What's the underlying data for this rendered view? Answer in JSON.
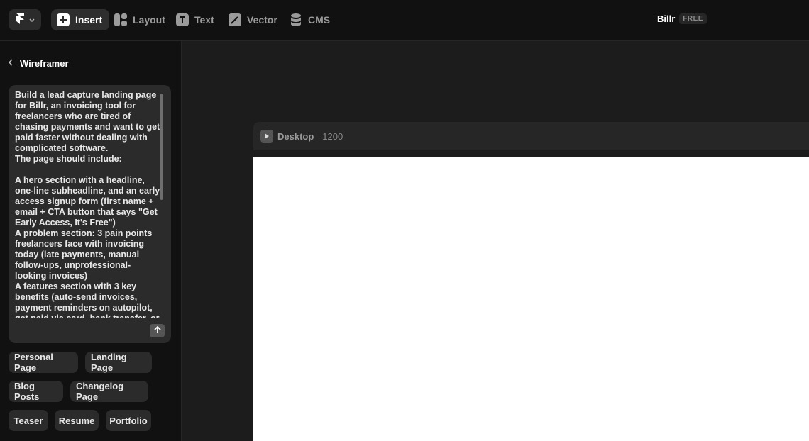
{
  "toolbar": {
    "tools": [
      {
        "label": "Insert",
        "icon": "plus-icon"
      },
      {
        "label": "Layout",
        "icon": "layout-icon"
      },
      {
        "label": "Text",
        "icon": "text-icon"
      },
      {
        "label": "Vector",
        "icon": "pen-icon"
      },
      {
        "label": "CMS",
        "icon": "database-icon"
      }
    ],
    "project_name": "Billr",
    "plan_badge": "FREE"
  },
  "sidebar": {
    "title": "Wireframer",
    "prompt": "Build a lead capture landing page for Billr, an invoicing tool for freelancers who are tired of chasing payments and want to get paid faster without dealing with complicated software.\nThe page should include:\n\nA hero section with a headline, one-line subheadline, and an early access signup form (first name + email + CTA button that says \"Get Early Access, It's Free\")\nA problem section: 3 pain points freelancers face with invoicing today (late payments, manual follow-ups, unprofessional-looking invoices)\nA features section with 3 key benefits (auto-send invoices, payment reminders on autopilot, get paid via card, bank transfer, or PayPal)",
    "templates": [
      "Personal Page",
      "Landing Page",
      "Blog Posts",
      "Changelog Page",
      "Teaser",
      "Resume",
      "Portfolio"
    ]
  },
  "canvas": {
    "frame_label": "Desktop",
    "frame_width": "1200"
  },
  "colors": {
    "topbar_bg": "#111111",
    "panel_bg": "#2b2b2b",
    "canvas_bg": "#1c1c1c",
    "frame_bg": "#ffffff"
  }
}
